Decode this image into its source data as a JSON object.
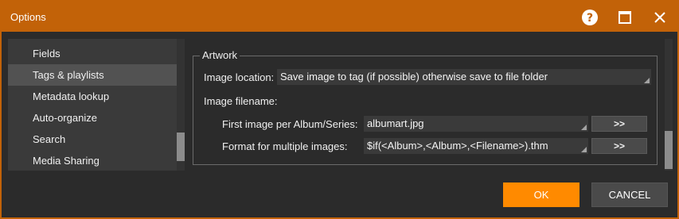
{
  "window": {
    "title": "Options"
  },
  "titlebar": {
    "help_icon": "help-circle-icon",
    "maximize_icon": "maximize-icon",
    "close_icon": "close-icon"
  },
  "sidebar": {
    "items": [
      {
        "label": "Fields",
        "selected": false
      },
      {
        "label": "Tags & playlists",
        "selected": true
      },
      {
        "label": "Metadata lookup",
        "selected": false
      },
      {
        "label": "Auto-organize",
        "selected": false
      },
      {
        "label": "Search",
        "selected": false
      },
      {
        "label": "Media Sharing",
        "selected": false
      }
    ]
  },
  "artwork": {
    "legend": "Artwork",
    "image_location_label": "Image location:",
    "image_location_value": "Save image to tag (if possible) otherwise save to file folder",
    "image_filename_label": "Image filename:",
    "first_image_label": "First image per Album/Series:",
    "first_image_value": "albumart.jpg",
    "first_image_button": ">>",
    "format_multiple_label": "Format for multiple images:",
    "format_multiple_value": "$if(<Album>,<Album>,<Filename>).thm",
    "format_multiple_button": ">>"
  },
  "footer": {
    "ok_label": "OK",
    "cancel_label": "CANCEL"
  },
  "colors": {
    "titlebar": "#c26208",
    "accent_button": "#ff8a00",
    "background": "#2b2b2b"
  }
}
